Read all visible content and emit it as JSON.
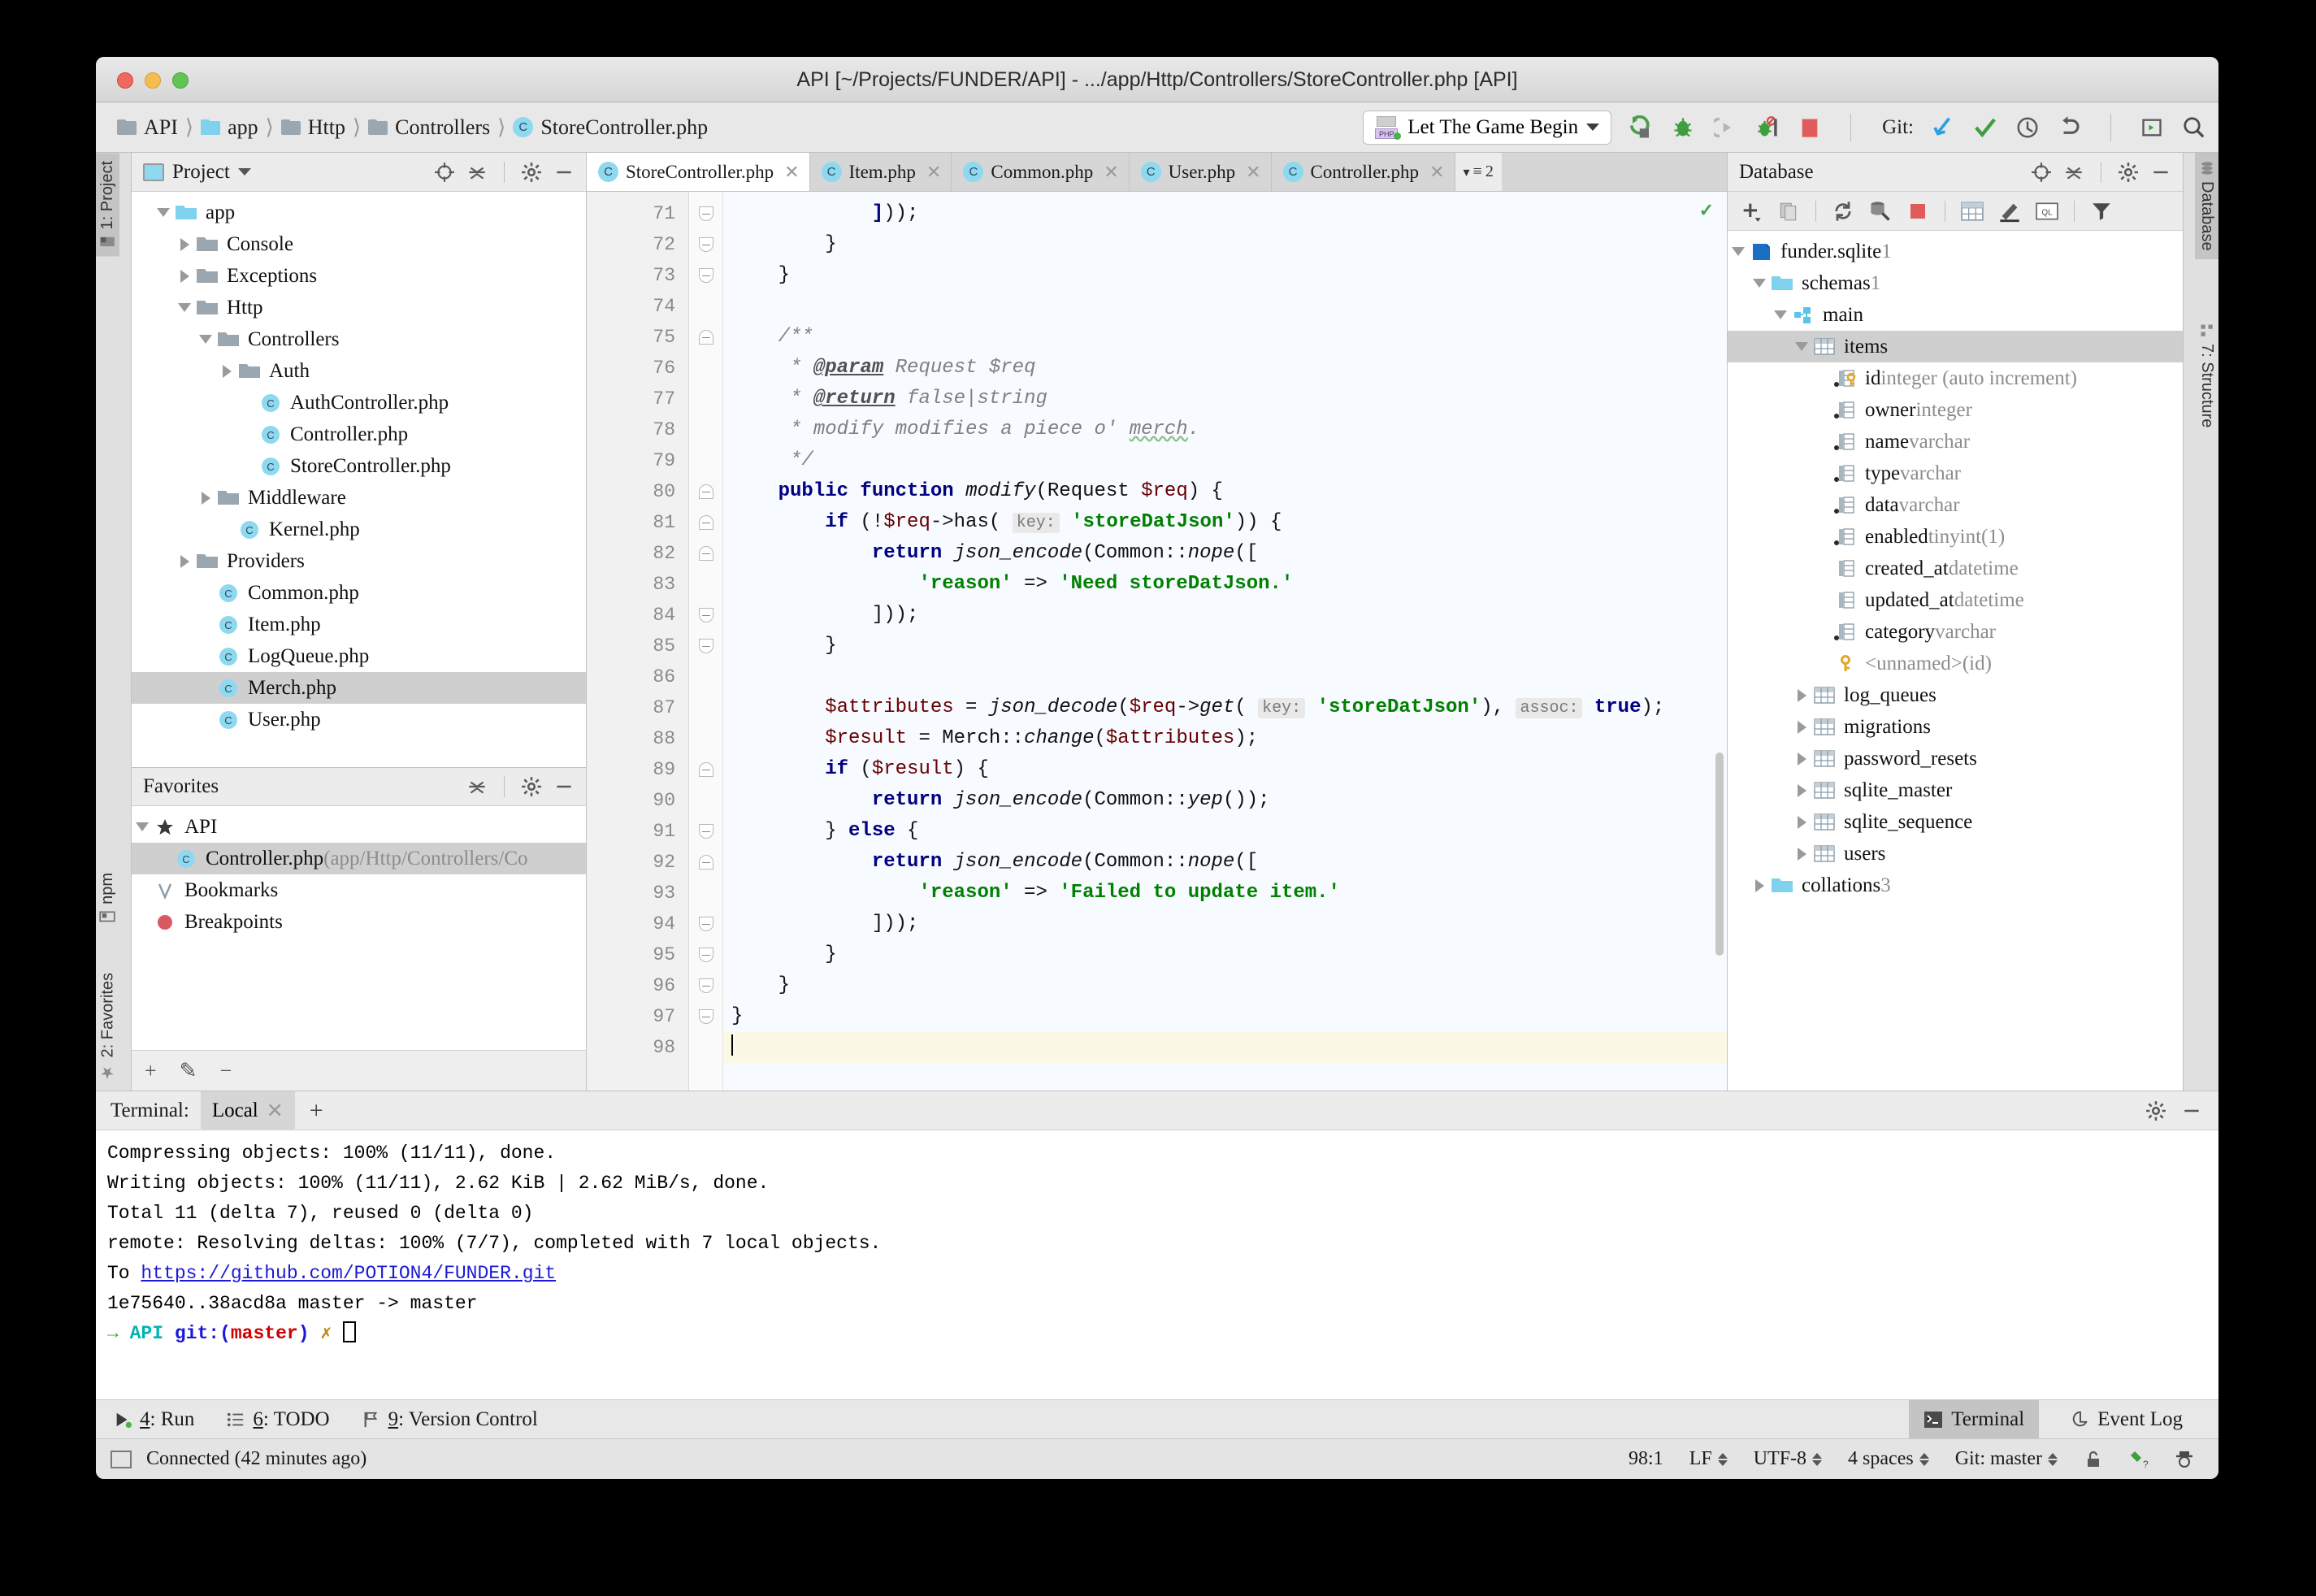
{
  "window": {
    "title": "API [~/Projects/FUNDER/API] - .../app/Http/Controllers/StoreController.php [API]"
  },
  "breadcrumb": [
    {
      "label": "API",
      "icon": "folder-icon"
    },
    {
      "label": "app",
      "icon": "folder-blue-icon"
    },
    {
      "label": "Http",
      "icon": "folder-icon"
    },
    {
      "label": "Controllers",
      "icon": "folder-icon"
    },
    {
      "label": "StoreController.php",
      "icon": "php-class-icon"
    }
  ],
  "toolbar": {
    "run_config": "Let The Game Begin",
    "git_label": "Git:",
    "icons": [
      "run-icon",
      "debug-icon",
      "run-with-coverage-icon",
      "stop-debug-icon",
      "stop-icon",
      "update-project-icon",
      "commit-icon",
      "history-icon",
      "rollback-icon",
      "run-anything-icon",
      "search-everywhere-icon"
    ]
  },
  "left_strip": [
    {
      "label": "1: Project",
      "selected": true,
      "icon": "project-icon"
    },
    {
      "label": "npm",
      "selected": false,
      "icon": "npm-icon"
    },
    {
      "label": "2: Favorites",
      "selected": false,
      "icon": "star-icon"
    }
  ],
  "right_strip": [
    {
      "label": "Database",
      "selected": true,
      "icon": "database-icon"
    },
    {
      "label": "7: Structure",
      "selected": false,
      "icon": "structure-icon"
    }
  ],
  "project_panel": {
    "title": "Project",
    "tree": [
      {
        "label": "app",
        "indent": 1,
        "twisty": "down",
        "icon": "folder-blue-icon",
        "selected": false
      },
      {
        "label": "Console",
        "indent": 2,
        "twisty": "right",
        "icon": "folder-icon",
        "selected": false
      },
      {
        "label": "Exceptions",
        "indent": 2,
        "twisty": "right",
        "icon": "folder-icon",
        "selected": false
      },
      {
        "label": "Http",
        "indent": 2,
        "twisty": "down",
        "icon": "folder-icon",
        "selected": false
      },
      {
        "label": "Controllers",
        "indent": 3,
        "twisty": "down",
        "icon": "folder-icon",
        "selected": false
      },
      {
        "label": "Auth",
        "indent": 4,
        "twisty": "right",
        "icon": "folder-icon",
        "selected": false
      },
      {
        "label": "AuthController.php",
        "indent": 5,
        "twisty": "none",
        "icon": "php-class-icon",
        "selected": false
      },
      {
        "label": "Controller.php",
        "indent": 5,
        "twisty": "none",
        "icon": "php-class-icon",
        "selected": false
      },
      {
        "label": "StoreController.php",
        "indent": 5,
        "twisty": "none",
        "icon": "php-class-icon",
        "selected": false
      },
      {
        "label": "Middleware",
        "indent": 3,
        "twisty": "right",
        "icon": "folder-icon",
        "selected": false
      },
      {
        "label": "Kernel.php",
        "indent": 4,
        "twisty": "none",
        "icon": "php-class-icon",
        "selected": false
      },
      {
        "label": "Providers",
        "indent": 2,
        "twisty": "right",
        "icon": "folder-icon",
        "selected": false
      },
      {
        "label": "Common.php",
        "indent": 3,
        "twisty": "none",
        "icon": "php-class-icon",
        "selected": false
      },
      {
        "label": "Item.php",
        "indent": 3,
        "twisty": "none",
        "icon": "php-class-icon",
        "selected": false
      },
      {
        "label": "LogQueue.php",
        "indent": 3,
        "twisty": "none",
        "icon": "php-class-icon",
        "selected": false
      },
      {
        "label": "Merch.php",
        "indent": 3,
        "twisty": "none",
        "icon": "php-class-icon",
        "selected": true
      },
      {
        "label": "User.php",
        "indent": 3,
        "twisty": "none",
        "icon": "php-class-icon",
        "selected": false
      }
    ]
  },
  "favorites_panel": {
    "title": "Favorites",
    "items": [
      {
        "label": "API",
        "sub": "",
        "indent": 1,
        "twisty": "down",
        "icon": "star-icon",
        "selected": false
      },
      {
        "label": "Controller.php",
        "sub": "(app/Http/Controllers/Co",
        "indent": 2,
        "twisty": "none",
        "icon": "php-class-icon",
        "selected": true
      },
      {
        "label": "Bookmarks",
        "sub": "",
        "indent": 1,
        "twisty": "none",
        "icon": "bookmark-check-icon",
        "selected": false
      },
      {
        "label": "Breakpoints",
        "sub": "",
        "indent": 1,
        "twisty": "none",
        "icon": "breakpoint-icon",
        "selected": false
      }
    ]
  },
  "editor": {
    "tabs": [
      {
        "label": "StoreController.php",
        "active": true
      },
      {
        "label": "Item.php",
        "active": false
      },
      {
        "label": "Common.php",
        "active": false
      },
      {
        "label": "User.php",
        "active": false
      },
      {
        "label": "Controller.php",
        "active": false
      }
    ],
    "tab_overflow": "2",
    "first_line": 71,
    "caret_line": 98,
    "lines": [
      {
        "n": 71,
        "fold": "end",
        "html": "            <span class='kw'>]</span>));"
      },
      {
        "n": 72,
        "fold": "end",
        "html": "        }"
      },
      {
        "n": 73,
        "fold": "end",
        "html": "    }"
      },
      {
        "n": 74,
        "fold": "none",
        "html": ""
      },
      {
        "n": 75,
        "fold": "start",
        "html": "    <span class='cmt'>/**</span>"
      },
      {
        "n": 76,
        "fold": "none",
        "html": "     <span class='cmt'>* </span><span class='tag'>@param</span><span class='cmt'> Request $req</span>"
      },
      {
        "n": 77,
        "fold": "none",
        "html": "     <span class='cmt'>* </span><span class='tag'>@return</span><span class='cmt'> false|string</span>"
      },
      {
        "n": 78,
        "fold": "none",
        "html": "     <span class='cmt'>* modify modifies a piece o' </span><span class='cmt typo'>merch</span><span class='cmt'>.</span>"
      },
      {
        "n": 79,
        "fold": "none",
        "html": "     <span class='cmt'>*/</span>"
      },
      {
        "n": 80,
        "fold": "start",
        "html": "    <span class='kw'>public function</span> <span class='fn'>modify</span>(Request <span class='var'>$req</span>) {"
      },
      {
        "n": 81,
        "fold": "start",
        "html": "        <span class='kw'>if</span> (!<span class='var'>$req</span>-&gt;has( <span class='hint'>key:</span> <span class='str'>'storeDatJson'</span>)) {"
      },
      {
        "n": 82,
        "fold": "start",
        "html": "            <span class='kw'>return</span> <span class='fn'>json_encode</span>(Common::<span class='fn'>nope</span>(["
      },
      {
        "n": 83,
        "fold": "none",
        "html": "                <span class='str'>'reason'</span> =&gt; <span class='str'>'Need storeDatJson.'</span>"
      },
      {
        "n": 84,
        "fold": "end",
        "html": "            ]));"
      },
      {
        "n": 85,
        "fold": "end",
        "html": "        }"
      },
      {
        "n": 86,
        "fold": "none",
        "html": ""
      },
      {
        "n": 87,
        "fold": "none",
        "html": "        <span class='var'>$attributes</span> = <span class='fn'>json_decode</span>(<span class='var'>$req</span>-&gt;<span class='fn'>get</span>( <span class='hint'>key:</span> <span class='str'>'storeDatJson'</span>), <span class='hint'>assoc:</span> <span class='kw'>true</span>);"
      },
      {
        "n": 88,
        "fold": "none",
        "html": "        <span class='var'>$result</span> = Merch::<span class='fn'>change</span>(<span class='var'>$attributes</span>);"
      },
      {
        "n": 89,
        "fold": "start",
        "html": "        <span class='kw'>if</span> (<span class='var'>$result</span>) {"
      },
      {
        "n": 90,
        "fold": "none",
        "html": "            <span class='kw'>return</span> <span class='fn'>json_encode</span>(Common::<span class='fn'>yep</span>());"
      },
      {
        "n": 91,
        "fold": "end",
        "html": "        } <span class='kw'>else</span> {"
      },
      {
        "n": 92,
        "fold": "start",
        "html": "            <span class='kw'>return</span> <span class='fn'>json_encode</span>(Common::<span class='fn'>nope</span>(["
      },
      {
        "n": 93,
        "fold": "none",
        "html": "                <span class='str'>'reason'</span> =&gt; <span class='str'>'Failed to update item.'</span>"
      },
      {
        "n": 94,
        "fold": "end",
        "html": "            ]));"
      },
      {
        "n": 95,
        "fold": "end",
        "html": "        }"
      },
      {
        "n": 96,
        "fold": "end",
        "html": "    }"
      },
      {
        "n": 97,
        "fold": "end",
        "html": "}"
      },
      {
        "n": 98,
        "fold": "none",
        "html": "<span class='caretbar'></span>",
        "current": true
      }
    ]
  },
  "database_panel": {
    "title": "Database",
    "toolbar_icons": [
      "add-icon",
      "duplicate-icon",
      "refresh-icon",
      "data-source-properties-icon",
      "stop-icon",
      "table-editor-icon",
      "modify-icon",
      "query-console-icon",
      "filter-icon"
    ],
    "tree": [
      {
        "label": "funder.sqlite",
        "meta": "1",
        "indent": 1,
        "twisty": "down",
        "icon": "sqlite-db-icon",
        "selected": false
      },
      {
        "label": "schemas",
        "meta": "1",
        "indent": 2,
        "twisty": "down",
        "icon": "folder-blue-icon",
        "selected": false
      },
      {
        "label": "main",
        "meta": "",
        "indent": 3,
        "twisty": "down",
        "icon": "schema-icon",
        "selected": false
      },
      {
        "label": "items",
        "meta": "",
        "indent": 4,
        "twisty": "down",
        "icon": "table-icon",
        "selected": true
      },
      {
        "label": "id",
        "meta": "integer (auto increment)",
        "indent": 5,
        "twisty": "none",
        "icon": "primary-key-column-icon",
        "selected": false
      },
      {
        "label": "owner",
        "meta": "integer",
        "indent": 5,
        "twisty": "none",
        "icon": "column-notnull-icon",
        "selected": false
      },
      {
        "label": "name",
        "meta": "varchar",
        "indent": 5,
        "twisty": "none",
        "icon": "column-notnull-icon",
        "selected": false
      },
      {
        "label": "type",
        "meta": "varchar",
        "indent": 5,
        "twisty": "none",
        "icon": "column-notnull-icon",
        "selected": false
      },
      {
        "label": "data",
        "meta": "varchar",
        "indent": 5,
        "twisty": "none",
        "icon": "column-notnull-icon",
        "selected": false
      },
      {
        "label": "enabled",
        "meta": "tinyint(1)",
        "indent": 5,
        "twisty": "none",
        "icon": "column-notnull-icon",
        "selected": false
      },
      {
        "label": "created_at",
        "meta": "datetime",
        "indent": 5,
        "twisty": "none",
        "icon": "column-icon",
        "selected": false
      },
      {
        "label": "updated_at",
        "meta": "datetime",
        "indent": 5,
        "twisty": "none",
        "icon": "column-icon",
        "selected": false
      },
      {
        "label": "category",
        "meta": "varchar",
        "indent": 5,
        "twisty": "none",
        "icon": "column-notnull-icon",
        "selected": false
      },
      {
        "label": "<unnamed>",
        "meta": "(id)",
        "indent": 5,
        "twisty": "none",
        "icon": "key-icon",
        "selected": false,
        "dim": true
      },
      {
        "label": "log_queues",
        "meta": "",
        "indent": 4,
        "twisty": "right",
        "icon": "table-icon",
        "selected": false
      },
      {
        "label": "migrations",
        "meta": "",
        "indent": 4,
        "twisty": "right",
        "icon": "table-icon",
        "selected": false
      },
      {
        "label": "password_resets",
        "meta": "",
        "indent": 4,
        "twisty": "right",
        "icon": "table-icon",
        "selected": false
      },
      {
        "label": "sqlite_master",
        "meta": "",
        "indent": 4,
        "twisty": "right",
        "icon": "table-icon",
        "selected": false
      },
      {
        "label": "sqlite_sequence",
        "meta": "",
        "indent": 4,
        "twisty": "right",
        "icon": "table-icon",
        "selected": false
      },
      {
        "label": "users",
        "meta": "",
        "indent": 4,
        "twisty": "right",
        "icon": "table-icon",
        "selected": false
      },
      {
        "label": "collations",
        "meta": "3",
        "indent": 2,
        "twisty": "right",
        "icon": "folder-blue-icon",
        "selected": false
      }
    ]
  },
  "terminal": {
    "label": "Terminal:",
    "tab": "Local",
    "lines": [
      {
        "text": "Compressing objects: 100% (11/11), done."
      },
      {
        "text": "Writing objects: 100% (11/11), 2.62 KiB | 2.62 MiB/s, done."
      },
      {
        "text": "Total 11 (delta 7), reused 0 (delta 0)"
      },
      {
        "text": "remote: Resolving deltas: 100% (7/7), completed with 7 local objects."
      },
      {
        "text": "To ",
        "link": "https://github.com/POTION4/FUNDER.git"
      },
      {
        "text": "   1e75640..38acd8a  master -> master"
      }
    ],
    "prompt": {
      "arrow": "→",
      "dir": "API",
      "git": "git:(",
      "branch": "master",
      "gitclose": ")",
      "mark": "✗"
    }
  },
  "bottom_tabs": [
    {
      "label": "4: Run",
      "num": "4",
      "rest": ": Run",
      "icon": "run-icon"
    },
    {
      "label": "6: TODO",
      "num": "6",
      "rest": ": TODO",
      "icon": "todo-icon"
    },
    {
      "label": "9: Version Control",
      "num": "9",
      "rest": ": Version Control",
      "icon": "vcs-icon"
    }
  ],
  "bottom_right_tabs": [
    {
      "label": "Terminal",
      "selected": true,
      "icon": "terminal-icon"
    },
    {
      "label": "Event Log",
      "selected": false,
      "icon": "event-log-icon"
    }
  ],
  "status_bar": {
    "message": "Connected (42 minutes ago)",
    "position": "98:1",
    "line_ending": "LF",
    "encoding": "UTF-8",
    "indent": "4 spaces",
    "git_branch": "Git: master",
    "icons": [
      "lock-open-icon",
      "inspection-icon",
      "hector-icon"
    ]
  },
  "colors": {
    "accent_blue": "#8ed8f0",
    "string_green": "#008000",
    "keyword_navy": "#000080",
    "variable_maroon": "#660000",
    "stop_red": "#e05c5c",
    "link_blue": "#1a1ad6"
  }
}
